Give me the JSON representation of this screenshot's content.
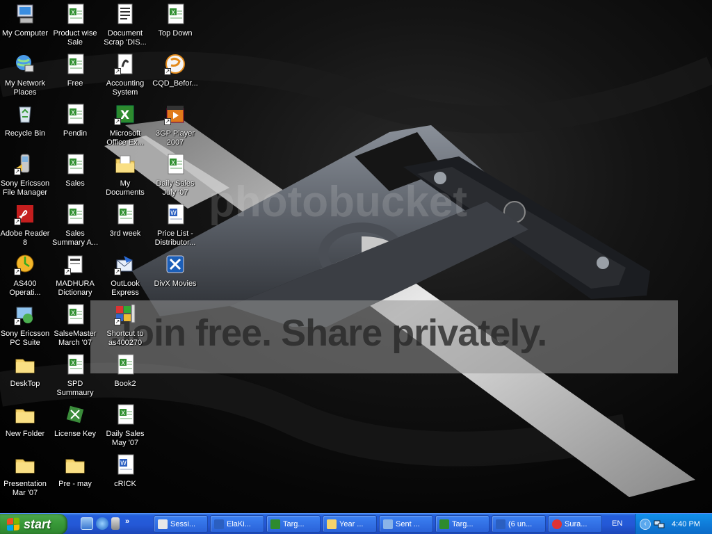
{
  "top_text": "",
  "watermark": {
    "logo_text": "photobucket",
    "banner_text": "Join free. Share privately."
  },
  "desktop_icons": [
    {
      "label": "My Computer",
      "icon": "my-computer-icon"
    },
    {
      "label": "My Network Places",
      "icon": "network-places-icon"
    },
    {
      "label": "Recycle Bin",
      "icon": "recycle-bin-icon"
    },
    {
      "label": "Sony Ericsson File Manager",
      "icon": "phone-icon"
    },
    {
      "label": "Adobe Reader 8",
      "icon": "pdf-icon"
    },
    {
      "label": "AS400 Operati...",
      "icon": "as400-icon"
    },
    {
      "label": "Sony Ericsson PC Suite",
      "icon": "pc-suite-icon"
    },
    {
      "label": "DeskTop",
      "icon": "folder-icon"
    },
    {
      "label": "New Folder",
      "icon": "folder-icon"
    },
    {
      "label": "Presentation Mar '07",
      "icon": "folder-icon"
    },
    {
      "label": "Product wise Sale",
      "icon": "excel-file-icon"
    },
    {
      "label": "Free",
      "icon": "excel-file-icon"
    },
    {
      "label": "Pendin",
      "icon": "excel-file-icon"
    },
    {
      "label": "Sales",
      "icon": "excel-file-icon"
    },
    {
      "label": "Sales Summary A...",
      "icon": "excel-file-icon"
    },
    {
      "label": "MADHURA Dictionary",
      "icon": "dictionary-icon"
    },
    {
      "label": "SalseMaster March '07",
      "icon": "excel-file-icon"
    },
    {
      "label": "SPD Summaury",
      "icon": "excel-file-icon"
    },
    {
      "label": "License Key",
      "icon": "license-key-icon"
    },
    {
      "label": "Pre - may",
      "icon": "folder-icon"
    },
    {
      "label": "Document Scrap 'DIS...",
      "icon": "text-document-icon"
    },
    {
      "label": "Accounting System",
      "icon": "accounting-app-icon"
    },
    {
      "label": "Microsoft Office Ex...",
      "icon": "excel-app-icon"
    },
    {
      "label": "My Documents",
      "icon": "my-documents-icon"
    },
    {
      "label": "3rd week",
      "icon": "excel-file-icon"
    },
    {
      "label": "OutLook Express",
      "icon": "outlook-express-icon"
    },
    {
      "label": "Shortcut to as400270",
      "icon": "as400-shortcut-icon"
    },
    {
      "label": "Book2",
      "icon": "excel-file-icon"
    },
    {
      "label": "Daily Sales May '07",
      "icon": "excel-file-icon"
    },
    {
      "label": "cRICK",
      "icon": "word-file-icon"
    },
    {
      "label": "Top Down",
      "icon": "excel-file-icon"
    },
    {
      "label": "CQD_Befor...",
      "icon": "media-app-icon"
    },
    {
      "label": "3GP Player 2007",
      "icon": "video-player-icon"
    },
    {
      "label": "Daily Sales July '07",
      "icon": "excel-file-icon"
    },
    {
      "label": "Price List - Distributor...",
      "icon": "word-file-icon"
    },
    {
      "label": "DivX Movies",
      "icon": "divx-icon"
    }
  ],
  "taskbar": {
    "start_label": "start",
    "quick_launch": [
      "show-desktop-icon",
      "internet-explorer-icon",
      "windows-media-icon"
    ],
    "quick_launch_more": "»",
    "buttons": [
      {
        "label": "Sessi...",
        "icon": "session-icon"
      },
      {
        "label": "ElaKi...",
        "icon": "word-icon"
      },
      {
        "label": "Targ...",
        "icon": "excel-icon"
      },
      {
        "label": "Year ...",
        "icon": "folder-icon"
      },
      {
        "label": "Sent ...",
        "icon": "mail-icon"
      },
      {
        "label": "Targ...",
        "icon": "excel-icon"
      },
      {
        "label": "(6 un...",
        "icon": "word-icon"
      },
      {
        "label": "Sura...",
        "icon": "stop-icon"
      }
    ],
    "language": "EN",
    "clock": "4:40 PM"
  }
}
